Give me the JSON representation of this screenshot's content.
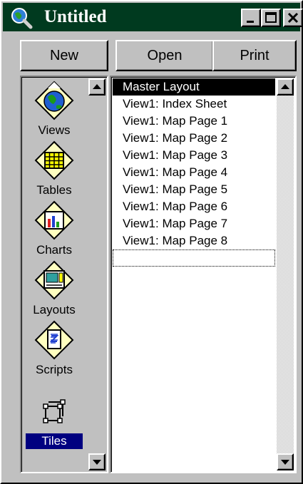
{
  "window": {
    "title": "Untitled",
    "title_bar_color": "#003a1f",
    "app_icon": "magnifier-globe-icon",
    "controls": [
      "minimize-icon",
      "maximize-icon",
      "close-icon"
    ]
  },
  "toolbar": {
    "new_label": "New",
    "open_label": "Open",
    "print_label": "Print"
  },
  "doc_types": [
    {
      "label": "Views",
      "icon": "globe-icon"
    },
    {
      "label": "Tables",
      "icon": "table-grid-icon"
    },
    {
      "label": "Charts",
      "icon": "bar-chart-icon"
    },
    {
      "label": "Layouts",
      "icon": "layout-icon"
    },
    {
      "label": "Scripts",
      "icon": "script-icon"
    },
    {
      "label": "Tiles",
      "icon": "tiles-icon",
      "selected": true
    }
  ],
  "documents": [
    {
      "label": "Master Layout",
      "selected": true
    },
    {
      "label": "View1: Index Sheet"
    },
    {
      "label": "View1: Map Page 1"
    },
    {
      "label": "View1: Map Page 2"
    },
    {
      "label": "View1: Map Page 3"
    },
    {
      "label": "View1: Map Page 4"
    },
    {
      "label": "View1: Map Page 5"
    },
    {
      "label": "View1: Map Page 6"
    },
    {
      "label": "View1: Map Page 7"
    },
    {
      "label": "View1: Map Page 8"
    }
  ],
  "colors": {
    "face": "#c0c0c0",
    "selection": "#000080",
    "list_selection": "#000000"
  }
}
